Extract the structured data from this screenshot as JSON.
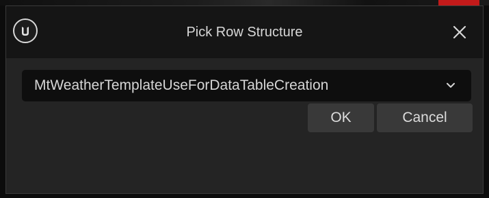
{
  "dialog": {
    "title": "Pick Row Structure",
    "logo_icon": "unreal-engine-logo-icon",
    "close_icon": "close-icon"
  },
  "structure_picker": {
    "selected_value": "MtWeatherTemplateUseForDataTableCreation",
    "arrow_icon": "chevron-down-icon"
  },
  "buttons": {
    "ok_label": "OK",
    "cancel_label": "Cancel"
  },
  "colors": {
    "dialog_background": "#242424",
    "titlebar_background": "#151515",
    "combo_background": "#0e0e0e",
    "button_background": "#393939",
    "text": "#d8d8d8"
  }
}
